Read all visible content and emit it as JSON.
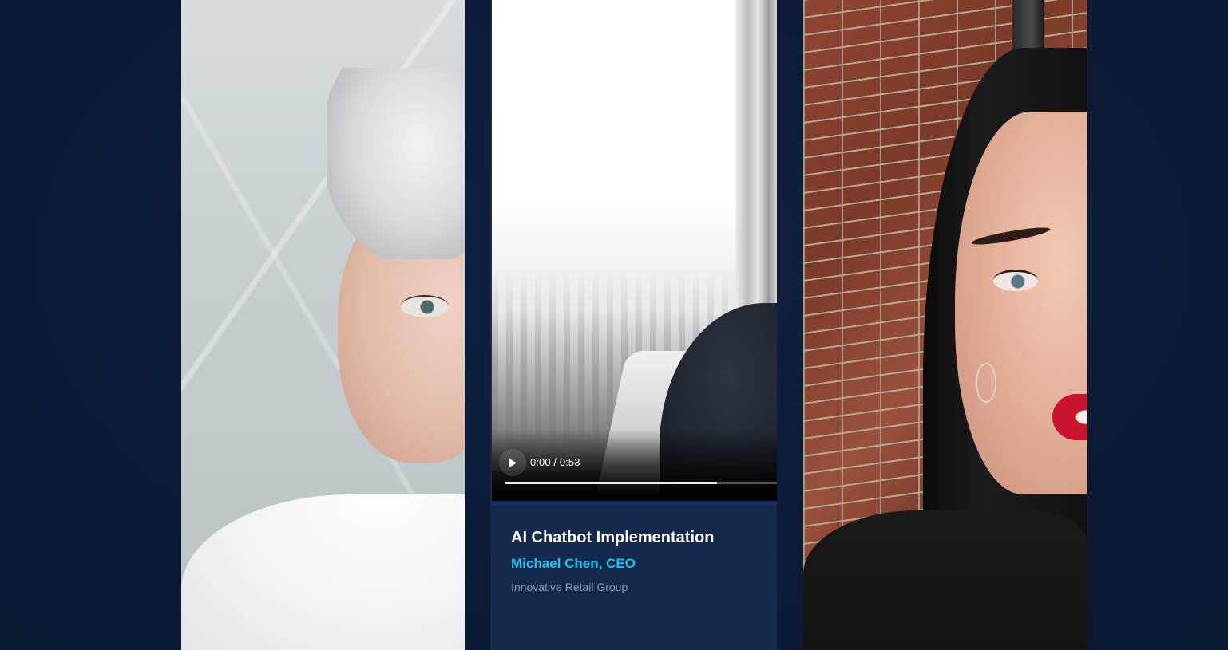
{
  "center_card": {
    "video": {
      "time": "0:00 / 0:53",
      "played_fraction": 0.0,
      "buffered_fraction": 0.78
    },
    "title": "AI Chatbot Implementation",
    "person": "Michael Chen, CEO",
    "company": "Innovative Retail Group"
  },
  "colors": {
    "page_background": "#0b1b35",
    "card_background": "#132a4c",
    "accent_name": "#1ec0f0",
    "company_text": "#8c9ab0"
  },
  "icons": {
    "play": "play-icon"
  }
}
